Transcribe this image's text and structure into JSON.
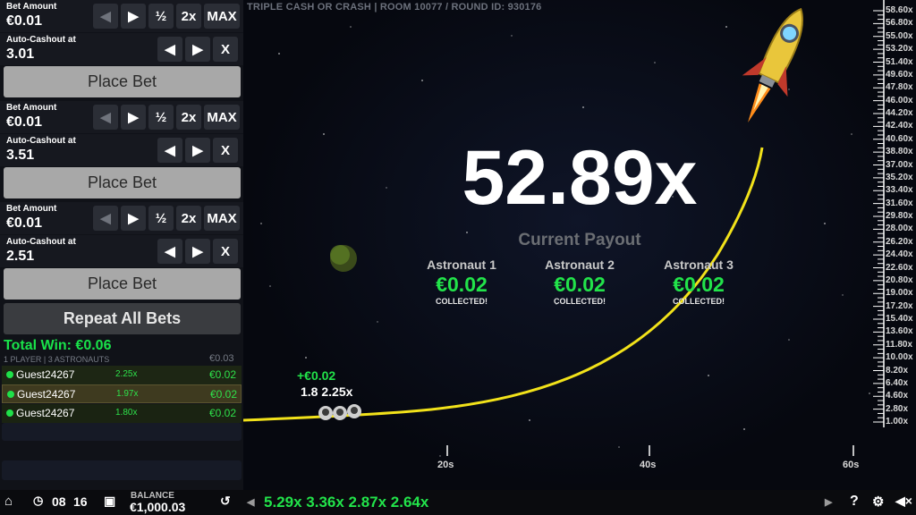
{
  "bets": [
    {
      "bet_amount_label": "Bet Amount",
      "bet_amount": "€0.01",
      "auto_cashout_label": "Auto-Cashout at",
      "auto_cashout": "3.01",
      "place_label": "Place Bet"
    },
    {
      "bet_amount_label": "Bet Amount",
      "bet_amount": "€0.01",
      "auto_cashout_label": "Auto-Cashout at",
      "auto_cashout": "3.51",
      "place_label": "Place Bet"
    },
    {
      "bet_amount_label": "Bet Amount",
      "bet_amount": "€0.01",
      "auto_cashout_label": "Auto-Cashout at",
      "auto_cashout": "2.51",
      "place_label": "Place Bet"
    }
  ],
  "controls": {
    "prev": "◀",
    "next": "▶",
    "half": "½",
    "double": "2x",
    "max": "MAX",
    "clear": "X"
  },
  "repeat_label": "Repeat All Bets",
  "total_win": "Total Win: €0.06",
  "players_info": "1 PLAYER | 3 ASTRONAUTS",
  "players_total": "€0.03",
  "players": [
    {
      "name": "Guest24267",
      "mult": "2.25x",
      "amount": "€0.02"
    },
    {
      "name": "Guest24267",
      "mult": "1.97x",
      "amount": "€0.02"
    },
    {
      "name": "Guest24267",
      "mult": "1.80x",
      "amount": "€0.02"
    }
  ],
  "header": "TRIPLE CASH OR CRASH   |   ROOM 10077 / ROUND ID: 930176",
  "multiplier": "52.89x",
  "payout_label": "Current Payout",
  "astronauts": [
    {
      "name": "Astronaut 1",
      "amount": "€0.02",
      "status": "COLLECTED!"
    },
    {
      "name": "Astronaut 2",
      "amount": "€0.02",
      "status": "COLLECTED!"
    },
    {
      "name": "Astronaut 3",
      "amount": "€0.02",
      "status": "COLLECTED!"
    }
  ],
  "overlay_green": "+€0.02",
  "overlay_white": "1.8 2.25x",
  "y_axis": [
    "58.60x",
    "56.80x",
    "55.00x",
    "53.20x",
    "51.40x",
    "49.60x",
    "47.80x",
    "46.00x",
    "44.20x",
    "42.40x",
    "40.60x",
    "38.80x",
    "37.00x",
    "35.20x",
    "33.40x",
    "31.60x",
    "29.80x",
    "28.00x",
    "26.20x",
    "24.40x",
    "22.60x",
    "20.80x",
    "19.00x",
    "17.20x",
    "15.40x",
    "13.60x",
    "11.80x",
    "10.00x",
    "8.20x",
    "6.40x",
    "4.60x",
    "2.80x",
    "1.00x"
  ],
  "x_axis": [
    "20s",
    "40s",
    "60s"
  ],
  "bottom": {
    "hour": "08",
    "minute": "16",
    "balance_label": "BALANCE",
    "balance": "€1,000.03",
    "history": "5.29x 3.36x 2.87x 2.64x",
    "help": "?",
    "next": "▶",
    "prev": "◀"
  }
}
